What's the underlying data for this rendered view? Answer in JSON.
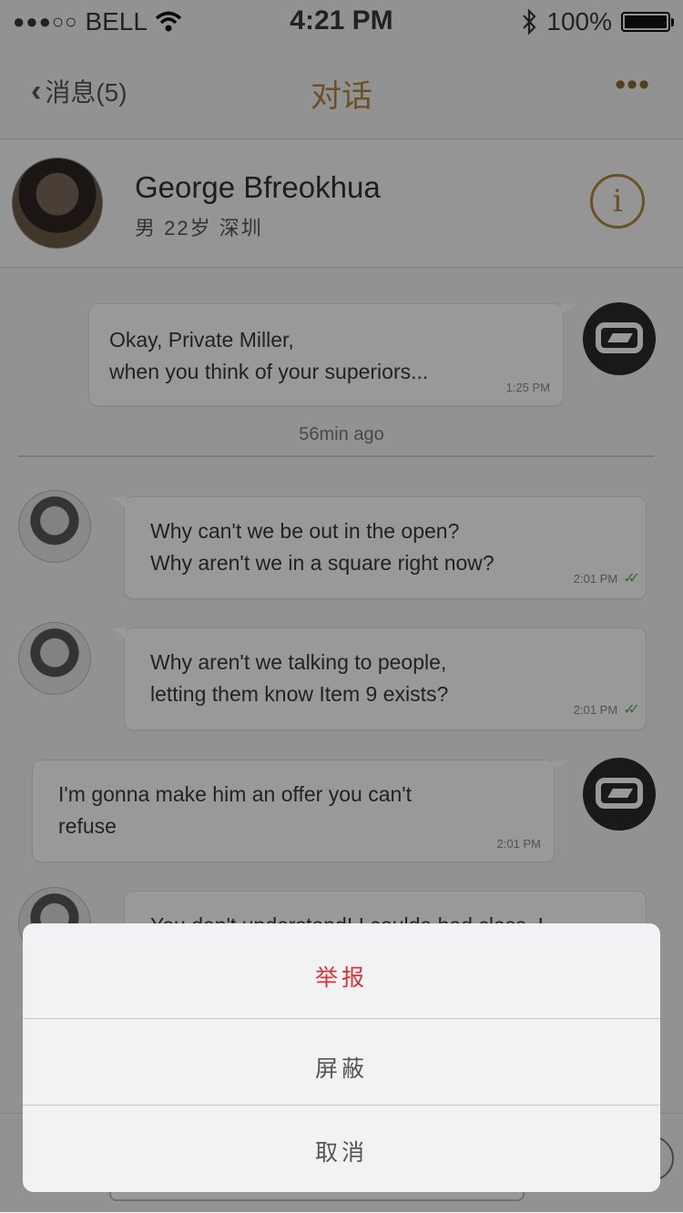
{
  "status_bar": {
    "signal_dots": "●●●○○",
    "carrier": "BELL",
    "time": "4:21 PM",
    "battery_percent_label": "100%",
    "battery_level": 1.0
  },
  "nav": {
    "back_label": "消息(5)",
    "title": "对话",
    "more_label": "•••"
  },
  "profile": {
    "name": "George Bfreokhua",
    "meta": "男 22岁 深圳",
    "info_label": "i"
  },
  "messages": [
    {
      "text": "Okay, Private Miller,\nwhen you think of your superiors...",
      "time": "1:25 PM"
    },
    {
      "text": "Why can't we be out in the open?\nWhy aren't we in a square right now?",
      "time": "2:01 PM"
    },
    {
      "text": "Why aren't we talking to people,\nletting them know Item 9 exists?",
      "time": "2:01 PM"
    },
    {
      "text": "I'm gonna make him an offer you can't\nrefuse",
      "time": "2:01 PM"
    },
    {
      "text": "You don't understand! I coulda had class. I",
      "time": ""
    }
  ],
  "timestamp_divider": "56min ago",
  "colors": {
    "accent_gold": "#b08a3c",
    "danger_red": "#d9343a",
    "check_green": "#56b35a"
  },
  "action_sheet": {
    "report_label": "举报",
    "block_label": "屏蔽",
    "cancel_label": "取消"
  }
}
